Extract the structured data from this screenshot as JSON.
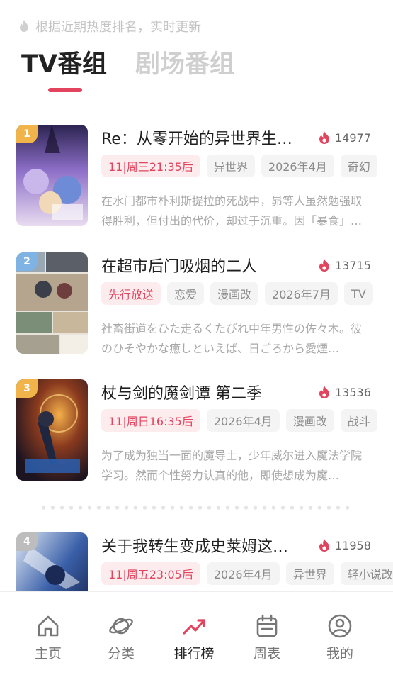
{
  "hint": "根据近期热度排名，实时更新",
  "tabs": [
    {
      "label": "TV番组",
      "active": true
    },
    {
      "label": "剧场番组",
      "active": false
    }
  ],
  "colors": {
    "accent": "#e2445e",
    "rank_1": "#f0b44a",
    "rank_2": "#7fb3e3",
    "rank_3": "#f0b44a",
    "rank_4": "#bdbdbd"
  },
  "items": [
    {
      "rank": "1",
      "title": "Re：从零开始的异世界生活 第四季",
      "heat": "14977",
      "tags": [
        "11|周三21:35后",
        "异世界",
        "2026年4月",
        "奇幻"
      ],
      "description": "在水门都市朴利斯提拉的死战中，昴等人虽然勉强取得胜利，但付出的代价，却过于沉重。因「暴食」…"
    },
    {
      "rank": "2",
      "title": "在超市后门吸烟的二人",
      "heat": "13715",
      "tags": [
        "先行放送",
        "恋爱",
        "漫画改",
        "2026年7月",
        "TV"
      ],
      "description": "社畜街道をひた走るくたびれ中年男性の佐々木。彼のひそやかな癒しといえば、日ごろから愛煙…"
    },
    {
      "rank": "3",
      "title": "杖与剑的魔剑谭 第二季",
      "heat": "13536",
      "tags": [
        "11|周日16:35后",
        "2026年4月",
        "漫画改",
        "战斗"
      ],
      "description": "为了成为独当一面的魔导士，少年威尔进入魔法学院学习。然而个性努力认真的他，即使想成为魔…"
    },
    {
      "rank": "4",
      "title": "关于我转生变成史莱姆这档事 第四季",
      "heat": "11958",
      "tags": [
        "11|周五23:05后",
        "2026年4月",
        "异世界",
        "轻小说改"
      ],
      "description": ""
    }
  ],
  "tabbar": [
    {
      "label": "主页",
      "icon": "home-icon",
      "active": false
    },
    {
      "label": "分类",
      "icon": "planet-icon",
      "active": false
    },
    {
      "label": "排行榜",
      "icon": "trending-icon",
      "active": true
    },
    {
      "label": "周表",
      "icon": "calendar-icon",
      "active": false
    },
    {
      "label": "我的",
      "icon": "user-icon",
      "active": false
    }
  ]
}
